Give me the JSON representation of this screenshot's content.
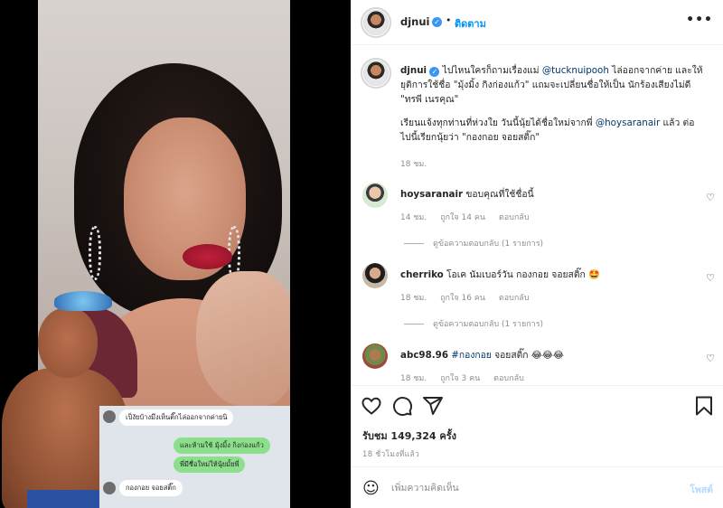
{
  "post": {
    "username": "djnui",
    "follow_label": "ติดตาม",
    "dot": "•",
    "more": "•••",
    "caption_lines": [
      "ไปไหนใครก็ถามเรื่องแม่ ",
      "@tucknuipooh",
      " ไล่ออกจากค่าย และให้",
      "ยุติการใช้ชื่อ \"มุ้งมิ้ง กิงก่องแก้ว\" แถมจะเปลี่ยนชื่อให้เป็น นักร้องเสียงไม่ดี",
      "\"ทรพี เนรคุณ\"",
      "เรียนแจ้งทุกท่านที่ห่วงใย วันนี้นุ้ยได้ชื่อใหม่จากพี่ ",
      "@hoysaranair",
      " แล้ว ต่อ",
      "ไปนี้เรียกนุ้ยว่า \"กองกอย จอยสติ๊ก\""
    ],
    "caption_time": "18 ชม.",
    "likes": "รับชม 149,324 ครั้ง",
    "posted": "18 ชั่วโมงที่แล้ว"
  },
  "comments": [
    {
      "user": "hoysaranair",
      "text": "ขอบคุณที่ใช้ชื่อนี้",
      "time": "14 ชม.",
      "likes": "ถูกใจ 14 คน",
      "reply": "ตอบกลับ",
      "view_replies": "ดูข้อความตอบกลับ (1 รายการ)"
    },
    {
      "user": "cherriko",
      "text": "โอเค นัมเบอร์วัน กองกอย จอยสติ๊ก 🤩",
      "time": "18 ชม.",
      "likes": "ถูกใจ 16 คน",
      "reply": "ตอบกลับ",
      "view_replies": "ดูข้อความตอบกลับ (1 รายการ)"
    },
    {
      "user": "abc98.96",
      "text_tag": "#กองกอย",
      "text": " จอยสติ๊ก 😂😂😂",
      "time": "18 ชม.",
      "likes": "ถูกใจ 3 คน",
      "reply": "ตอบกลับ"
    }
  ],
  "chat_overlay": {
    "msg1": "เป็งัยบ้างมึงเห็นติ๊กไล่ออกจากค่ายนิ",
    "msg2": "และห้ามใช้ มุ้งมิ้ง กิงก่องแก้ว",
    "msg3": "พี่มีชื่อใหม่ให้นุ้ยมั้ยพี่",
    "msg4": "กองกอย  จอยสติ๊ก"
  },
  "add_comment": {
    "placeholder": "เพิ่มความคิดเห็น",
    "post_label": "โพสต์"
  },
  "icons": {
    "verified": "verified-badge",
    "like": "heart-icon",
    "comment": "comment-icon",
    "share": "share-icon",
    "save": "bookmark-icon",
    "emoji": "emoji-icon"
  },
  "colors": {
    "accent": "#0095f6",
    "post_disabled": "#b3dbff",
    "muted": "#8e8e8e"
  }
}
